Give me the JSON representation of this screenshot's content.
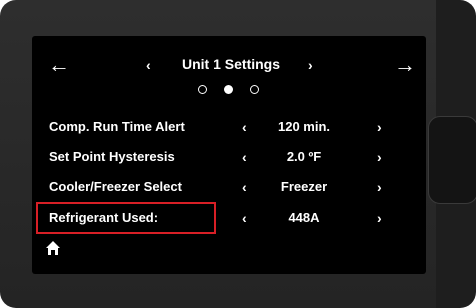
{
  "header": {
    "back_icon": "arrow-left-icon",
    "forward_icon": "arrow-right-icon",
    "prev_icon": "chevron-left-icon",
    "next_icon": "chevron-right-icon",
    "title": "Unit 1 Settings",
    "page_dots": {
      "count": 3,
      "active_index": 1
    }
  },
  "settings": [
    {
      "label": "Comp. Run Time Alert",
      "value": "120 min."
    },
    {
      "label": "Set Point Hysteresis",
      "value": "2.0 ºF"
    },
    {
      "label": "Cooler/Freezer Select",
      "value": "Freezer"
    },
    {
      "label": "Refrigerant Used:",
      "value": "448A",
      "highlighted": true
    }
  ],
  "glyphs": {
    "left": "‹",
    "right": "›",
    "back": "←",
    "forward": "→"
  },
  "footer": {
    "home_icon": "home-icon"
  },
  "colors": {
    "screen_bg": "#000000",
    "text": "#ffffff",
    "highlight": "#d81f26",
    "bezel": "#2a2a2a"
  }
}
